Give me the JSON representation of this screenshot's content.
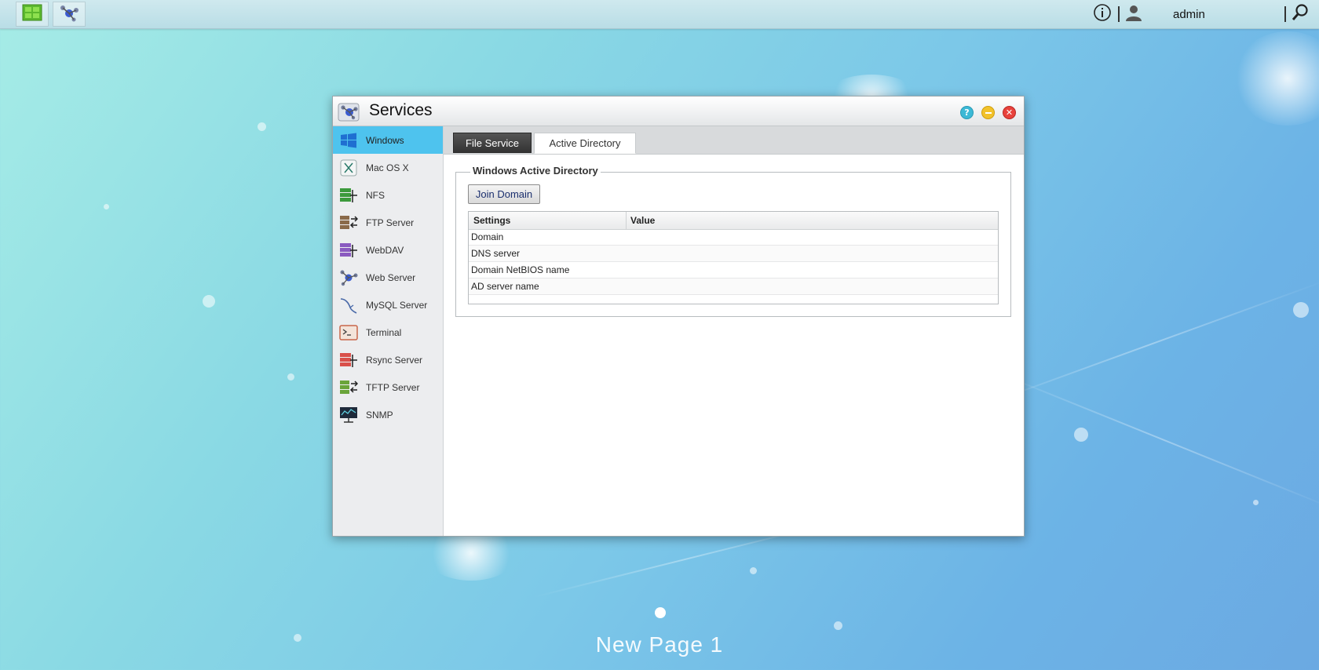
{
  "taskbar": {
    "apps": [
      {
        "name": "storage-app",
        "icon": "green-storage-icon"
      },
      {
        "name": "services-app",
        "icon": "services-icon"
      }
    ],
    "user": "admin"
  },
  "window": {
    "title": "Services",
    "controls": [
      "help",
      "minimize",
      "close"
    ]
  },
  "sidebar": {
    "items": [
      {
        "label": "Windows",
        "icon": "windows-icon",
        "active": true
      },
      {
        "label": "Mac OS X",
        "icon": "macosx-icon"
      },
      {
        "label": "NFS",
        "icon": "nfs-icon"
      },
      {
        "label": "FTP Server",
        "icon": "ftp-server-icon"
      },
      {
        "label": "WebDAV",
        "icon": "webdav-icon"
      },
      {
        "label": "Web Server",
        "icon": "web-server-icon"
      },
      {
        "label": "MySQL Server",
        "icon": "mysql-server-icon"
      },
      {
        "label": "Terminal",
        "icon": "terminal-icon"
      },
      {
        "label": "Rsync Server",
        "icon": "rsync-server-icon"
      },
      {
        "label": "TFTP Server",
        "icon": "tftp-server-icon"
      },
      {
        "label": "SNMP",
        "icon": "snmp-icon"
      }
    ]
  },
  "tabs": [
    {
      "label": "File Service",
      "active": false
    },
    {
      "label": "Active Directory",
      "active": true
    }
  ],
  "ad": {
    "legend": "Windows Active Directory",
    "join_button": "Join Domain",
    "columns": [
      "Settings",
      "Value"
    ],
    "rows": [
      {
        "setting": "Domain",
        "value": ""
      },
      {
        "setting": "DNS server",
        "value": ""
      },
      {
        "setting": "Domain NetBIOS name",
        "value": ""
      },
      {
        "setting": "AD server name",
        "value": ""
      }
    ]
  },
  "desktop": {
    "page_label": "New Page 1"
  },
  "colors": {
    "active_item": "#4ec3ee",
    "help": "#3cb9d6",
    "minimize": "#f2c22b",
    "close": "#e8423c"
  }
}
